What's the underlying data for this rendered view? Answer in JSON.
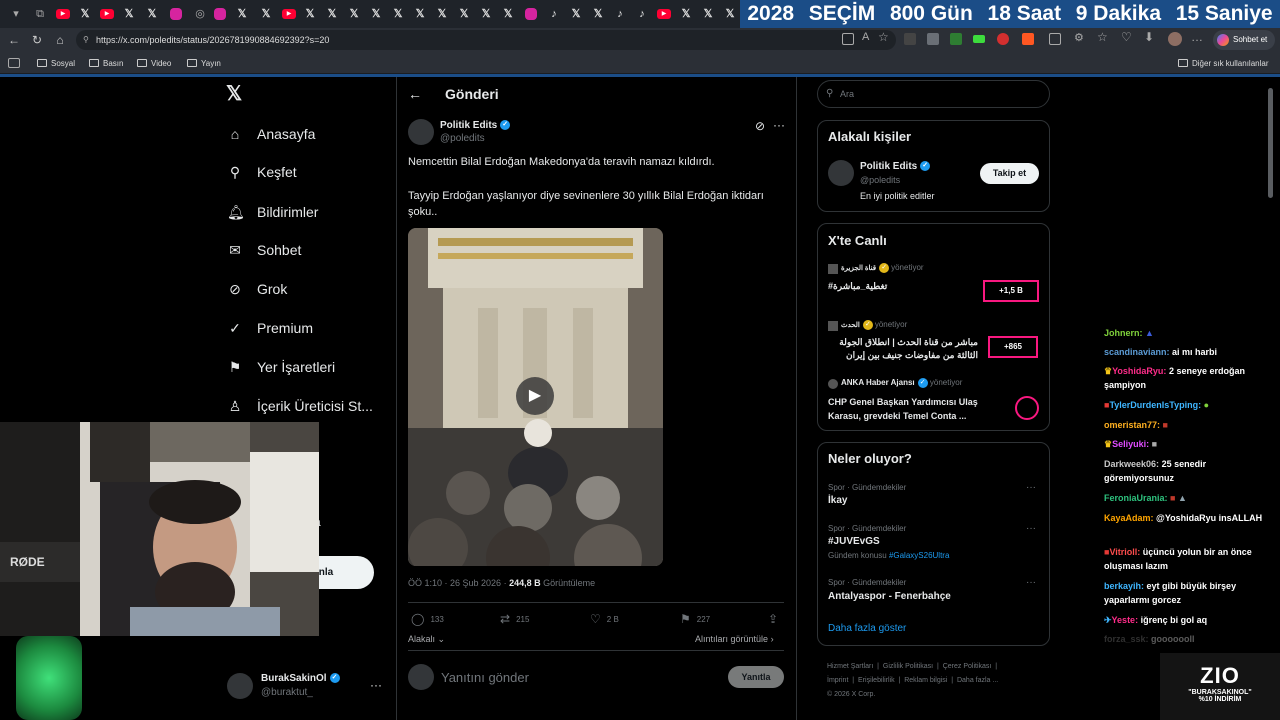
{
  "browser": {
    "banner": {
      "year": "2028",
      "word": "SEÇİM",
      "days": "800 Gün",
      "hours": "18 Saat",
      "minutes": "9 Dakika",
      "seconds": "15 Saniye"
    },
    "url": "https://x.com/poledits/status/2026781990884692392?s=20",
    "chat_button": "Sohbet et",
    "bookmarks": [
      "Sosyal",
      "Basın",
      "Video",
      "Yayın"
    ],
    "other_bookmarks": "Diğer sık kullanılanlar",
    "colors": {
      "banner": "#1b4d87"
    }
  },
  "nav": {
    "items": [
      {
        "label": "Anasayfa",
        "icon": "home-icon"
      },
      {
        "label": "Keşfet",
        "icon": "search-icon"
      },
      {
        "label": "Bildirimler",
        "icon": "bell-icon"
      },
      {
        "label": "Sohbet",
        "icon": "mail-icon"
      },
      {
        "label": "Grok",
        "icon": "grok-icon"
      },
      {
        "label": "Premium",
        "icon": "premium-icon"
      },
      {
        "label": "Yer İşaretleri",
        "icon": "bookmark-icon"
      },
      {
        "label": "İçerik Üreticisi St...",
        "icon": "creator-icon"
      }
    ],
    "partial_text": "a",
    "login_button": "ınla"
  },
  "account": {
    "name": "BurakSakinOl",
    "handle": "@buraktut_",
    "more": "···"
  },
  "post": {
    "header": "Gönderi",
    "author": "Politik Edits",
    "handle": "@poledits",
    "text1": "Nemcettin Bilal Erdoğan Makedonya'da teravih namazı kıldırdı.",
    "text2": "Tayyip Erdoğan yaşlanıyor diye sevinenlere 30 yıllık Bilal Erdoğan iktidarı şoku..",
    "time": "ÖÖ 1:10 · 26 Şub 2026 ·",
    "views": "244,8 B",
    "views_label": "Görüntüleme",
    "replies": "133",
    "reposts": "215",
    "likes": "2 B",
    "bookmarks": "227",
    "relevant": "Alakalı",
    "quotes": "Alıntıları görüntüle",
    "reply_placeholder": "Yanıtını gönder",
    "reply_button": "Yanıtla"
  },
  "sidebar": {
    "search_placeholder": "Ara",
    "related": {
      "title": "Alakalı kişiler",
      "name": "Politik Edits",
      "handle": "@poledits",
      "bio": "En iyi politik editler",
      "follow": "Takip et"
    },
    "live": {
      "title": "X'te Canlı",
      "items": [
        {
          "host": "قناة الجزيرة",
          "role": "yönetiyor",
          "title": "#تغطية_مباشرة",
          "count": "+1,5 B"
        },
        {
          "host": "الحدث",
          "role": "yönetiyor",
          "title": "مباشر من قناة الحدث | انطلاق الجولة الثالثة من مفاوضات جنيف بين إيران",
          "count": "+865"
        },
        {
          "host": "ANKA Haber Ajansı",
          "role": "yönetiyor",
          "title": "CHP Genel Başkan Yardımcısı Ulaş Karasu, grevdeki Temel Conta ...",
          "count": ""
        }
      ]
    },
    "trends": {
      "title": "Neler oluyor?",
      "items": [
        {
          "category": "Spor · Gündemdekiler",
          "name": "İkay",
          "extra_label": "",
          "extra_tag": ""
        },
        {
          "category": "Spor · Gündemdekiler",
          "name": "#JUVEvGS",
          "extra_label": "Gündem konusu",
          "extra_tag": "#GalaxyS26Ultra"
        },
        {
          "category": "Spor · Gündemdekiler",
          "name": "Antalyaspor - Fenerbahçe",
          "extra_label": "",
          "extra_tag": ""
        }
      ],
      "more": "Daha fazla göster"
    },
    "footer": [
      "Hizmet Şartları",
      "Gizlilik Politikası",
      "Çerez Politikası",
      "İmprint",
      "Erişilebilirlik",
      "Reklam bilgisi",
      "Daha fazla ...",
      "© 2026 X Corp."
    ]
  },
  "chat": [
    {
      "user": "Johnern:",
      "color": "#7fd13b",
      "msg": ""
    },
    {
      "user": "scandinaviann:",
      "color": "#5b9bd5",
      "msg": "ai mı harbi"
    },
    {
      "user": "YoshidaRyu:",
      "color": "#ff2d8a",
      "msg": "2 seneye erdoğan şampiyon"
    },
    {
      "user": "TylerDurdenIsTyping:",
      "color": "#3fb6ff",
      "msg": ""
    },
    {
      "user": "omeristan77:",
      "color": "#ffb020",
      "msg": ""
    },
    {
      "user": "Seliyuki:",
      "color": "#e04cff",
      "msg": ""
    },
    {
      "user": "Darkweek06:",
      "color": "#c9c9c9",
      "msg": "25 senedir göremiyorsunuz"
    },
    {
      "user": "FeroniaUrania:",
      "color": "#2ec27e",
      "msg": ""
    },
    {
      "user": "KayaAdam:",
      "color": "#ffa500",
      "msg": "@YoshidaRyu insALLAH"
    },
    {
      "user": "Vitrioll:",
      "color": "#ff4d4d",
      "msg": "üçüncü yolun bir an önce oluşması lazım"
    },
    {
      "user": "berkayih:",
      "color": "#3fb6ff",
      "msg": "eyt gibi büyük birşey yaparlarmı gorcez"
    },
    {
      "user": "Yeste:",
      "color": "#ff2d8a",
      "msg": "iğrenç bi gol aq"
    },
    {
      "user": "forza_ssk:",
      "color": "#888888",
      "msg": "gooooooll"
    }
  ],
  "promo": {
    "brand": "ZIO",
    "line1": "\"BURAKSAKINOL\"",
    "line2": "%10 İNDİRİM"
  },
  "cam_label": "RØDE"
}
